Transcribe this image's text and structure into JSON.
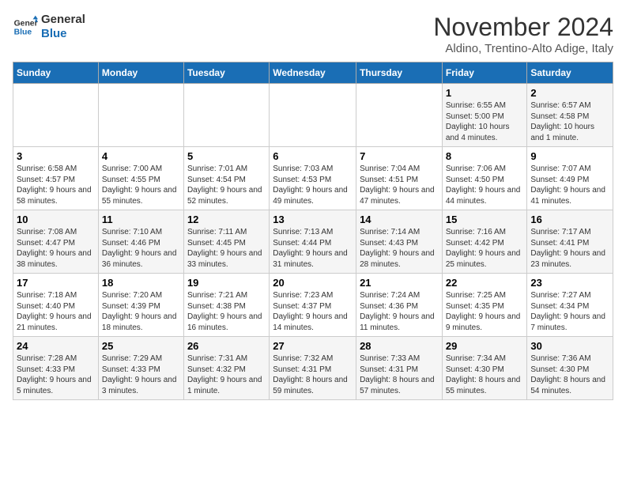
{
  "logo": {
    "line1": "General",
    "line2": "Blue"
  },
  "title": "November 2024",
  "location": "Aldino, Trentino-Alto Adige, Italy",
  "weekdays": [
    "Sunday",
    "Monday",
    "Tuesday",
    "Wednesday",
    "Thursday",
    "Friday",
    "Saturday"
  ],
  "weeks": [
    [
      {
        "day": "",
        "info": ""
      },
      {
        "day": "",
        "info": ""
      },
      {
        "day": "",
        "info": ""
      },
      {
        "day": "",
        "info": ""
      },
      {
        "day": "",
        "info": ""
      },
      {
        "day": "1",
        "info": "Sunrise: 6:55 AM\nSunset: 5:00 PM\nDaylight: 10 hours and 4 minutes."
      },
      {
        "day": "2",
        "info": "Sunrise: 6:57 AM\nSunset: 4:58 PM\nDaylight: 10 hours and 1 minute."
      }
    ],
    [
      {
        "day": "3",
        "info": "Sunrise: 6:58 AM\nSunset: 4:57 PM\nDaylight: 9 hours and 58 minutes."
      },
      {
        "day": "4",
        "info": "Sunrise: 7:00 AM\nSunset: 4:55 PM\nDaylight: 9 hours and 55 minutes."
      },
      {
        "day": "5",
        "info": "Sunrise: 7:01 AM\nSunset: 4:54 PM\nDaylight: 9 hours and 52 minutes."
      },
      {
        "day": "6",
        "info": "Sunrise: 7:03 AM\nSunset: 4:53 PM\nDaylight: 9 hours and 49 minutes."
      },
      {
        "day": "7",
        "info": "Sunrise: 7:04 AM\nSunset: 4:51 PM\nDaylight: 9 hours and 47 minutes."
      },
      {
        "day": "8",
        "info": "Sunrise: 7:06 AM\nSunset: 4:50 PM\nDaylight: 9 hours and 44 minutes."
      },
      {
        "day": "9",
        "info": "Sunrise: 7:07 AM\nSunset: 4:49 PM\nDaylight: 9 hours and 41 minutes."
      }
    ],
    [
      {
        "day": "10",
        "info": "Sunrise: 7:08 AM\nSunset: 4:47 PM\nDaylight: 9 hours and 38 minutes."
      },
      {
        "day": "11",
        "info": "Sunrise: 7:10 AM\nSunset: 4:46 PM\nDaylight: 9 hours and 36 minutes."
      },
      {
        "day": "12",
        "info": "Sunrise: 7:11 AM\nSunset: 4:45 PM\nDaylight: 9 hours and 33 minutes."
      },
      {
        "day": "13",
        "info": "Sunrise: 7:13 AM\nSunset: 4:44 PM\nDaylight: 9 hours and 31 minutes."
      },
      {
        "day": "14",
        "info": "Sunrise: 7:14 AM\nSunset: 4:43 PM\nDaylight: 9 hours and 28 minutes."
      },
      {
        "day": "15",
        "info": "Sunrise: 7:16 AM\nSunset: 4:42 PM\nDaylight: 9 hours and 25 minutes."
      },
      {
        "day": "16",
        "info": "Sunrise: 7:17 AM\nSunset: 4:41 PM\nDaylight: 9 hours and 23 minutes."
      }
    ],
    [
      {
        "day": "17",
        "info": "Sunrise: 7:18 AM\nSunset: 4:40 PM\nDaylight: 9 hours and 21 minutes."
      },
      {
        "day": "18",
        "info": "Sunrise: 7:20 AM\nSunset: 4:39 PM\nDaylight: 9 hours and 18 minutes."
      },
      {
        "day": "19",
        "info": "Sunrise: 7:21 AM\nSunset: 4:38 PM\nDaylight: 9 hours and 16 minutes."
      },
      {
        "day": "20",
        "info": "Sunrise: 7:23 AM\nSunset: 4:37 PM\nDaylight: 9 hours and 14 minutes."
      },
      {
        "day": "21",
        "info": "Sunrise: 7:24 AM\nSunset: 4:36 PM\nDaylight: 9 hours and 11 minutes."
      },
      {
        "day": "22",
        "info": "Sunrise: 7:25 AM\nSunset: 4:35 PM\nDaylight: 9 hours and 9 minutes."
      },
      {
        "day": "23",
        "info": "Sunrise: 7:27 AM\nSunset: 4:34 PM\nDaylight: 9 hours and 7 minutes."
      }
    ],
    [
      {
        "day": "24",
        "info": "Sunrise: 7:28 AM\nSunset: 4:33 PM\nDaylight: 9 hours and 5 minutes."
      },
      {
        "day": "25",
        "info": "Sunrise: 7:29 AM\nSunset: 4:33 PM\nDaylight: 9 hours and 3 minutes."
      },
      {
        "day": "26",
        "info": "Sunrise: 7:31 AM\nSunset: 4:32 PM\nDaylight: 9 hours and 1 minute."
      },
      {
        "day": "27",
        "info": "Sunrise: 7:32 AM\nSunset: 4:31 PM\nDaylight: 8 hours and 59 minutes."
      },
      {
        "day": "28",
        "info": "Sunrise: 7:33 AM\nSunset: 4:31 PM\nDaylight: 8 hours and 57 minutes."
      },
      {
        "day": "29",
        "info": "Sunrise: 7:34 AM\nSunset: 4:30 PM\nDaylight: 8 hours and 55 minutes."
      },
      {
        "day": "30",
        "info": "Sunrise: 7:36 AM\nSunset: 4:30 PM\nDaylight: 8 hours and 54 minutes."
      }
    ]
  ]
}
